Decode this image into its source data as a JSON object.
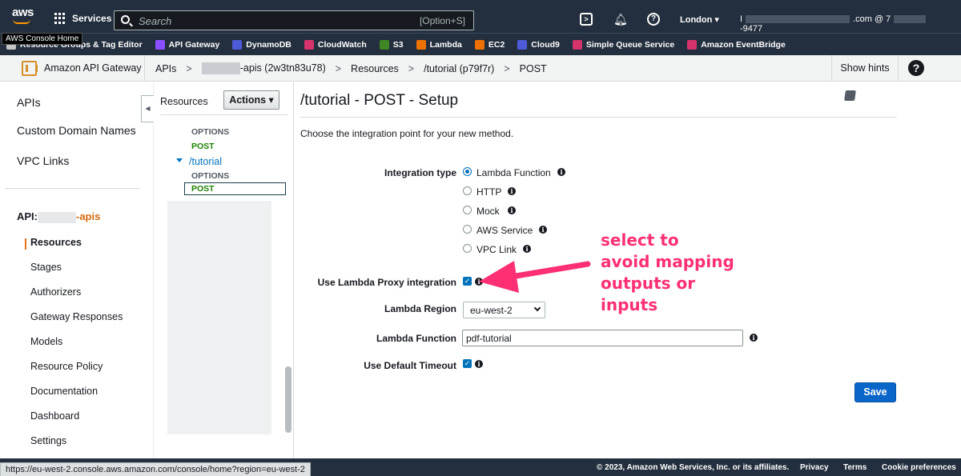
{
  "topnav": {
    "logo_text": "aws",
    "services_label": "Services",
    "search_placeholder": "Search",
    "search_shortcut": "[Option+S]",
    "region": "London",
    "account_prefix": "I",
    "account_mid": ".com @ 7",
    "account_suffix": "-9477"
  },
  "tooltip": "AWS Console Home",
  "favorites": [
    {
      "label": "Resource Groups & Tag Editor",
      "color": "#c7c7c7"
    },
    {
      "label": "API Gateway",
      "color": "#8c4fff"
    },
    {
      "label": "DynamoDB",
      "color": "#4d5bd8"
    },
    {
      "label": "CloudWatch",
      "color": "#d6336c"
    },
    {
      "label": "S3",
      "color": "#3f8624"
    },
    {
      "label": "Lambda",
      "color": "#ed7100"
    },
    {
      "label": "EC2",
      "color": "#ed7100"
    },
    {
      "label": "Cloud9",
      "color": "#4d5bd8"
    },
    {
      "label": "Simple Queue Service",
      "color": "#d6336c"
    },
    {
      "label": "Amazon EventBridge",
      "color": "#d6336c"
    }
  ],
  "crumbbar": {
    "service": "Amazon API Gateway",
    "crumbs": {
      "apis": "APIs",
      "api_name": "-apis (2w3tn83u78)",
      "resources": "Resources",
      "resource": "/tutorial (p79f7r)",
      "method": "POST"
    },
    "sep": ">",
    "hints": "Show hints",
    "help": "?"
  },
  "leftnav": {
    "top": [
      "APIs",
      "Custom Domain Names",
      "VPC Links"
    ],
    "api_prefix": "API:",
    "api_suffix": "-apis",
    "items": [
      "Resources",
      "Stages",
      "Authorizers",
      "Gateway Responses",
      "Models",
      "Resource Policy",
      "Documentation",
      "Dashboard",
      "Settings"
    ]
  },
  "tree": {
    "title": "Resources",
    "actions": "Actions",
    "options_1": "OPTIONS",
    "post_1": "POST",
    "resource": "/tutorial",
    "options_2": "OPTIONS",
    "post_2": "POST"
  },
  "main": {
    "title": "/tutorial - POST - Setup",
    "description": "Choose the integration point for your new method.",
    "integration_type_label": "Integration type",
    "integration_options": [
      "Lambda Function",
      "HTTP",
      "Mock",
      "AWS Service",
      "VPC Link"
    ],
    "selected_option": "Lambda Function",
    "proxy_label": "Use Lambda Proxy integration",
    "proxy_checked": true,
    "region_label": "Lambda Region",
    "region_value": "eu-west-2",
    "function_label": "Lambda Function",
    "function_value": "pdf-tutorial",
    "timeout_label": "Use Default Timeout",
    "timeout_checked": true,
    "save": "Save"
  },
  "annotation": {
    "lines": [
      "select to",
      "avoid mapping",
      "outputs or",
      "inputs"
    ],
    "color": "#ff2f73"
  },
  "footer": {
    "status_url": "https://eu-west-2.console.aws.amazon.com/console/home?region=eu-west-2",
    "copyright": "© 2023, Amazon Web Services, Inc. or its affiliates.",
    "links": [
      "Privacy",
      "Terms",
      "Cookie preferences"
    ]
  }
}
